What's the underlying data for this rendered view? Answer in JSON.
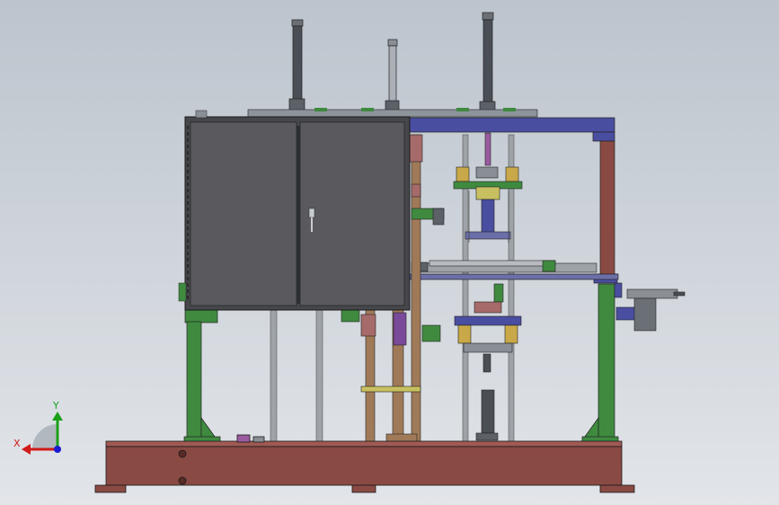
{
  "viewport": {
    "background_top": "#bcc4cd",
    "background_bottom": "#e2e5e9"
  },
  "triad": {
    "x_label": "X",
    "y_label": "Y",
    "x_color": "#d11a1a",
    "y_color": "#1aa01a",
    "z_color": "#1a1ad1"
  },
  "colors": {
    "base_frame": "#8a4a44",
    "cabinet": "#5a5a5e",
    "frame_blue": "#4a4ea0",
    "leg_green": "#3f8a3f",
    "column_brown": "#a07a58",
    "cylinder_dark": "#4a4f56",
    "accent_yellow": "#c8a848",
    "accent_purple": "#7a4a9a"
  }
}
